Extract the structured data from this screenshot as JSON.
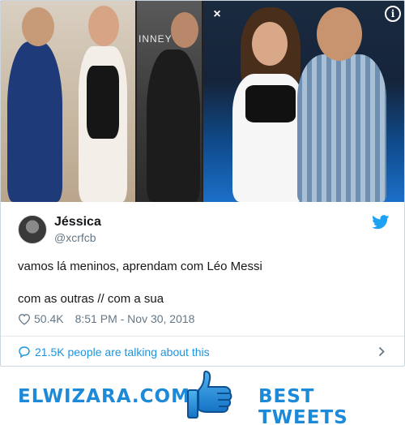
{
  "media": {
    "close_label": "×",
    "info_label": "i",
    "sign_text": "INNEY"
  },
  "tweet": {
    "display_name": "Jéssica",
    "handle": "@xcrfcb",
    "text_line_1": "vamos lá meninos, aprendam com Léo Messi",
    "text_line_2": "com as outras // com a sua",
    "likes": "50.4K",
    "timestamp": "8:51 PM - Nov 30, 2018",
    "talking": "21.5K people are talking about this"
  },
  "footer": {
    "brand_left": "ELWIZARA.COM",
    "brand_right": "BEST TWEETS"
  },
  "colors": {
    "accent": "#1b95e0",
    "brand": "#1c8ad9",
    "muted": "#657786",
    "border": "#e1e8ed"
  },
  "icons": [
    "close-icon",
    "info-icon",
    "twitter-bird-icon",
    "heart-icon",
    "speech-bubble-icon",
    "chevron-right-icon",
    "thumbs-up-icon"
  ]
}
